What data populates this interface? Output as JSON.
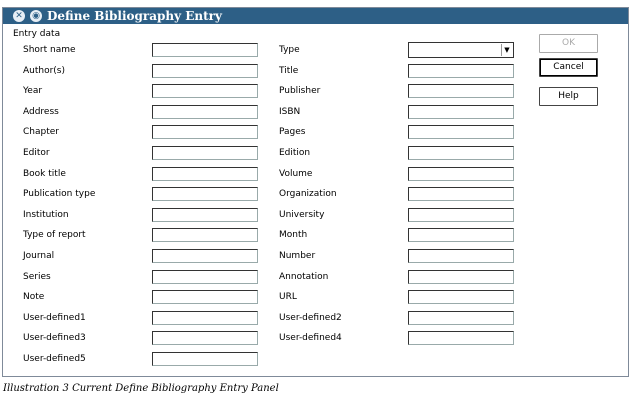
{
  "window": {
    "title": "Define Bibliography Entry",
    "group_label": "Entry data"
  },
  "left_fields": [
    {
      "label": "Short name",
      "value": ""
    },
    {
      "label": "Author(s)",
      "value": ""
    },
    {
      "label": "Year",
      "value": ""
    },
    {
      "label": "Address",
      "value": ""
    },
    {
      "label": "Chapter",
      "value": ""
    },
    {
      "label": "Editor",
      "value": ""
    },
    {
      "label": "Book title",
      "value": ""
    },
    {
      "label": "Publication type",
      "value": ""
    },
    {
      "label": "Institution",
      "value": ""
    },
    {
      "label": "Type of report",
      "value": ""
    },
    {
      "label": "Journal",
      "value": ""
    },
    {
      "label": "Series",
      "value": ""
    },
    {
      "label": "Note",
      "value": ""
    },
    {
      "label": "User-defined1",
      "value": ""
    },
    {
      "label": "User-defined3",
      "value": ""
    },
    {
      "label": "User-defined5",
      "value": ""
    }
  ],
  "right_fields": [
    {
      "label": "Type",
      "value": ""
    },
    {
      "label": "Title",
      "value": ""
    },
    {
      "label": "Publisher",
      "value": ""
    },
    {
      "label": "ISBN",
      "value": ""
    },
    {
      "label": "Pages",
      "value": ""
    },
    {
      "label": "Edition",
      "value": ""
    },
    {
      "label": "Volume",
      "value": ""
    },
    {
      "label": "Organization",
      "value": ""
    },
    {
      "label": "University",
      "value": ""
    },
    {
      "label": "Month",
      "value": ""
    },
    {
      "label": "Number",
      "value": ""
    },
    {
      "label": "Annotation",
      "value": ""
    },
    {
      "label": "URL",
      "value": ""
    },
    {
      "label": "User-defined2",
      "value": ""
    },
    {
      "label": "User-defined4",
      "value": ""
    }
  ],
  "buttons": {
    "ok": "OK",
    "cancel": "Cancel",
    "help": "Help"
  },
  "caption": "Illustration 3 Current Define Bibliography Entry Panel",
  "colors": {
    "titlebar": "#2d5f86",
    "border": "#7f8a99"
  }
}
